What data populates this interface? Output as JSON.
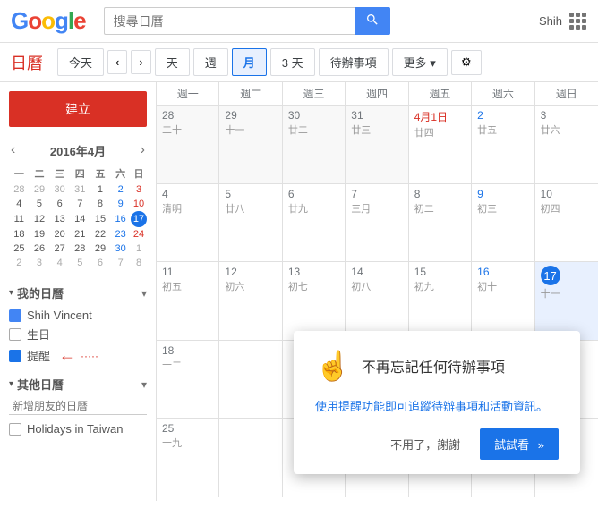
{
  "header": {
    "search_placeholder": "搜尋日曆",
    "user_name": "Shih",
    "apps_label": "應用程式"
  },
  "toolbar": {
    "cal_title": "日曆",
    "today_btn": "今天",
    "prev_btn": "‹",
    "next_btn": "›",
    "day_btn": "天",
    "week_btn": "週",
    "month_btn": "月",
    "three_day_btn": "3 天",
    "todo_btn": "待辦事項",
    "more_btn": "更多",
    "gear_btn": "⚙"
  },
  "sidebar": {
    "create_btn": "建立",
    "mini_cal_title": "2016年4月",
    "mini_cal_prev": "‹",
    "mini_cal_next": "›",
    "weekdays": [
      "一",
      "二",
      "三",
      "四",
      "五",
      "六",
      "日"
    ],
    "weeks": [
      [
        "28",
        "29",
        "30",
        "31",
        "1",
        "2",
        "3"
      ],
      [
        "4",
        "5",
        "6",
        "7",
        "8",
        "9",
        "10"
      ],
      [
        "11",
        "12",
        "13",
        "14",
        "15",
        "16",
        "17"
      ],
      [
        "18",
        "19",
        "20",
        "21",
        "22",
        "23",
        "24"
      ],
      [
        "25",
        "26",
        "27",
        "28",
        "29",
        "30",
        "1"
      ],
      [
        "2",
        "3",
        "4",
        "5",
        "6",
        "7",
        "8"
      ]
    ],
    "week_types": [
      [
        "om",
        "om",
        "om",
        "om",
        "n",
        "sat",
        "sun"
      ],
      [
        "n",
        "n",
        "n",
        "n",
        "n",
        "sat",
        "sun"
      ],
      [
        "n",
        "n",
        "n",
        "n",
        "n",
        "sat",
        "today"
      ],
      [
        "n",
        "n",
        "n",
        "n",
        "n",
        "sat",
        "sun"
      ],
      [
        "n",
        "n",
        "n",
        "n",
        "n",
        "sat",
        "nm"
      ],
      [
        "nm",
        "nm",
        "nm",
        "nm",
        "nm",
        "nm",
        "nm"
      ]
    ],
    "my_cals_label": "我的日曆",
    "other_cals_label": "其他日曆",
    "cal_items": [
      {
        "label": "Shih Vincent",
        "color": "#4285F4"
      },
      {
        "label": "生日",
        "color": "transparent",
        "border": "#aaa"
      },
      {
        "label": "提醒",
        "color": "#1a73e8",
        "has_arrow": true
      }
    ],
    "new_friend_placeholder": "新增朋友的日曆",
    "other_cal_items": [
      {
        "label": "Holidays in Taiwan",
        "color": "transparent",
        "border": "#aaa"
      }
    ]
  },
  "calendar": {
    "day_headers": [
      "週一",
      "週二",
      "週三",
      "週四",
      "週五",
      "週六",
      "週日"
    ],
    "weeks": [
      {
        "cells": [
          {
            "date": "28",
            "lunar": "二十",
            "type": "other"
          },
          {
            "date": "29",
            "lunar": "十一",
            "type": "other"
          },
          {
            "date": "30",
            "lunar": "廿二",
            "type": "other"
          },
          {
            "date": "31",
            "lunar": "廿三",
            "type": "other"
          },
          {
            "date": "4月1日",
            "lunar": "廿四",
            "type": "red"
          },
          {
            "date": "2",
            "lunar": "廿五",
            "type": "sat"
          },
          {
            "date": "3",
            "lunar": "廿六",
            "type": "sun"
          }
        ]
      },
      {
        "cells": [
          {
            "date": "4",
            "lunar": "清明",
            "type": "normal"
          },
          {
            "date": "5",
            "lunar": "廿八",
            "type": "normal"
          },
          {
            "date": "6",
            "lunar": "廿九",
            "type": "normal"
          },
          {
            "date": "7",
            "lunar": "三月",
            "type": "normal"
          },
          {
            "date": "8",
            "lunar": "初二",
            "type": "normal"
          },
          {
            "date": "9",
            "lunar": "初三",
            "type": "sat"
          },
          {
            "date": "10",
            "lunar": "初四",
            "type": "sun"
          }
        ]
      },
      {
        "cells": [
          {
            "date": "11",
            "lunar": "初五",
            "type": "normal"
          },
          {
            "date": "12",
            "lunar": "初六",
            "type": "normal"
          },
          {
            "date": "13",
            "lunar": "初七",
            "type": "normal"
          },
          {
            "date": "14",
            "lunar": "初八",
            "type": "normal"
          },
          {
            "date": "15",
            "lunar": "初九",
            "type": "normal"
          },
          {
            "date": "16",
            "lunar": "初十",
            "type": "sat"
          },
          {
            "date": "17",
            "lunar": "十一",
            "type": "today"
          }
        ]
      },
      {
        "cells": [
          {
            "date": "18",
            "lunar": "十二",
            "type": "normal"
          },
          {
            "date": "",
            "lunar": "",
            "type": "normal"
          },
          {
            "date": "",
            "lunar": "",
            "type": "normal"
          },
          {
            "date": "",
            "lunar": "",
            "type": "normal"
          },
          {
            "date": "",
            "lunar": "",
            "type": "normal"
          },
          {
            "date": "",
            "lunar": "",
            "type": "sat"
          },
          {
            "date": "",
            "lunar": "",
            "type": "sun"
          }
        ]
      },
      {
        "cells": [
          {
            "date": "25",
            "lunar": "十九",
            "type": "normal"
          },
          {
            "date": "",
            "lunar": "",
            "type": "normal"
          },
          {
            "date": "",
            "lunar": "",
            "type": "normal"
          },
          {
            "date": "",
            "lunar": "",
            "type": "normal"
          },
          {
            "date": "",
            "lunar": "",
            "type": "normal"
          },
          {
            "date": "",
            "lunar": "",
            "type": "sat"
          },
          {
            "date": "",
            "lunar": "",
            "type": "sun"
          }
        ]
      }
    ]
  },
  "popup": {
    "icon": "☝",
    "title": "不再忘記任何待辦事項",
    "desc": "使用提醒功能即可追蹤待辦事項和活動資訊。",
    "dismiss_btn": "不用了，謝謝",
    "try_btn": "試試看"
  }
}
